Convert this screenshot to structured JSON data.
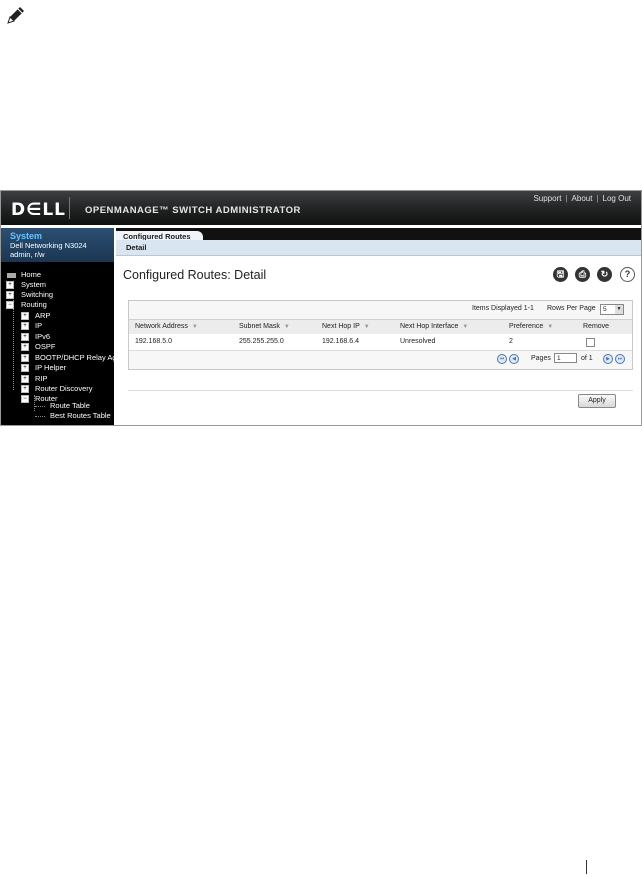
{
  "banner": {
    "logo": "D∈LL",
    "product": "OPENMANAGE™ SWITCH ADMINISTRATOR",
    "links": [
      "Support",
      "About",
      "Log Out"
    ]
  },
  "system": {
    "title": "System",
    "model": "Dell Networking N3024",
    "user": "admin, r/w"
  },
  "nav": {
    "home": "Home",
    "system": "System",
    "switching": "Switching",
    "routing": "Routing",
    "arp": "ARP",
    "ip": "IP",
    "ipv6": "IPv6",
    "ospf": "OSPF",
    "bootp": "BOOTP/DHCP Relay Agent",
    "iphelper": "IP Helper",
    "rip": "RIP",
    "router_discovery": "Router Discovery",
    "router": "Router",
    "route_table": "Route Table",
    "best_routes": "Best Routes Table"
  },
  "tabs": {
    "active": "Configured Routes",
    "sub": "Detail"
  },
  "page": {
    "title": "Configured Routes: Detail"
  },
  "table": {
    "items_displayed": "Items Displayed 1-1",
    "rows_per_page_label": "Rows Per Page",
    "rows_per_page": "5",
    "headers": [
      "Network Address",
      "Subnet Mask",
      "Next Hop IP",
      "Next Hop Interface",
      "Preference",
      "Remove"
    ],
    "row": [
      "192.168.5.0",
      "255.255.255.0",
      "192.168.6.4",
      "Unresolved",
      "2"
    ],
    "pages_label": "Pages",
    "page_value": "1",
    "of_label": "of 1"
  },
  "buttons": {
    "apply": "Apply"
  }
}
